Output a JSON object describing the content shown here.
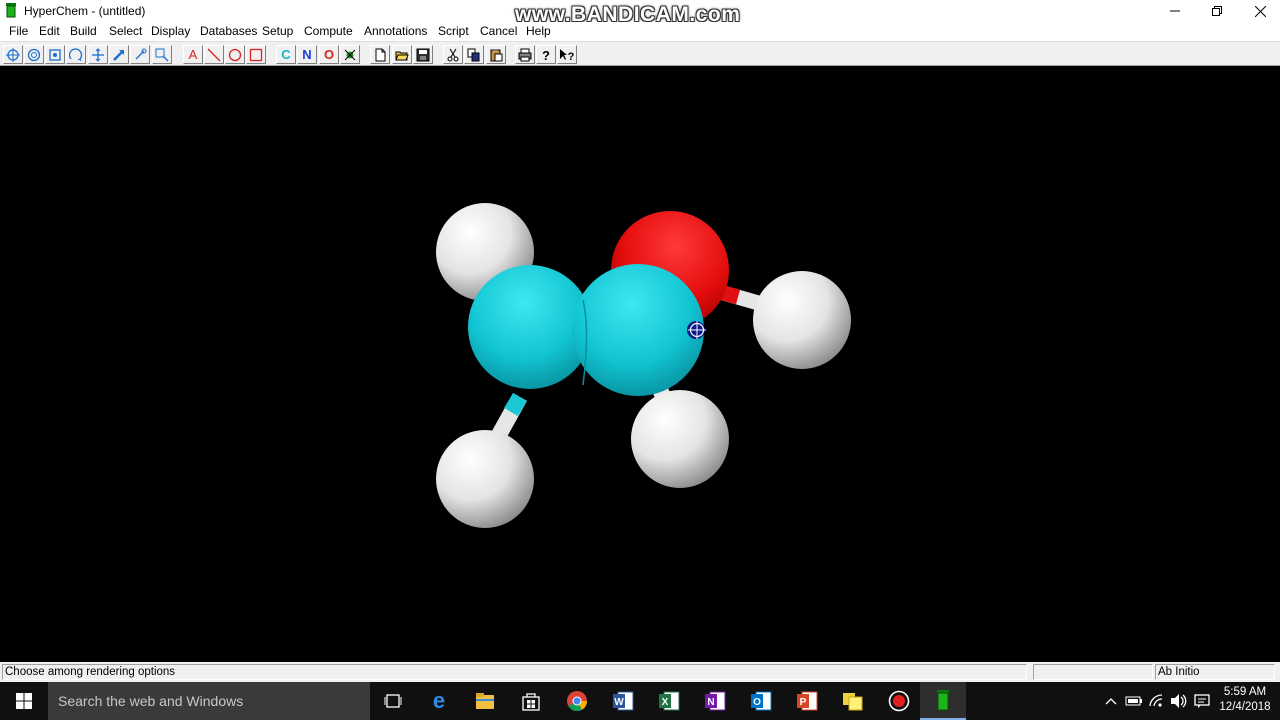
{
  "window": {
    "title": "HyperChem - (untitled)",
    "watermark": "www.BANDICAM.com",
    "controls": {
      "minimize": "—",
      "restore": "❐",
      "close": "✕"
    }
  },
  "menu": [
    "File",
    "Edit",
    "Build",
    "Select",
    "Display",
    "Databases",
    "Setup",
    "Compute",
    "Annotations",
    "Script",
    "Cancel",
    "Help"
  ],
  "toolbar": {
    "draw_letter": "A",
    "carbon_label": "C",
    "nitrogen_label": "N",
    "oxygen_label": "O"
  },
  "molecule": {
    "atoms": [
      "C",
      "C",
      "O",
      "H",
      "H",
      "H",
      "H"
    ],
    "colors": {
      "carbon": "#19c8d4",
      "oxygen": "#e01010",
      "hydrogen": "#f0f0f0",
      "background": "#000000"
    }
  },
  "status": {
    "message": "Choose among rendering options",
    "middle": "",
    "method": "Ab Initio"
  },
  "taskbar": {
    "search_placeholder": "Search the web and Windows",
    "time": "5:59 AM",
    "date": "12/4/2018"
  }
}
